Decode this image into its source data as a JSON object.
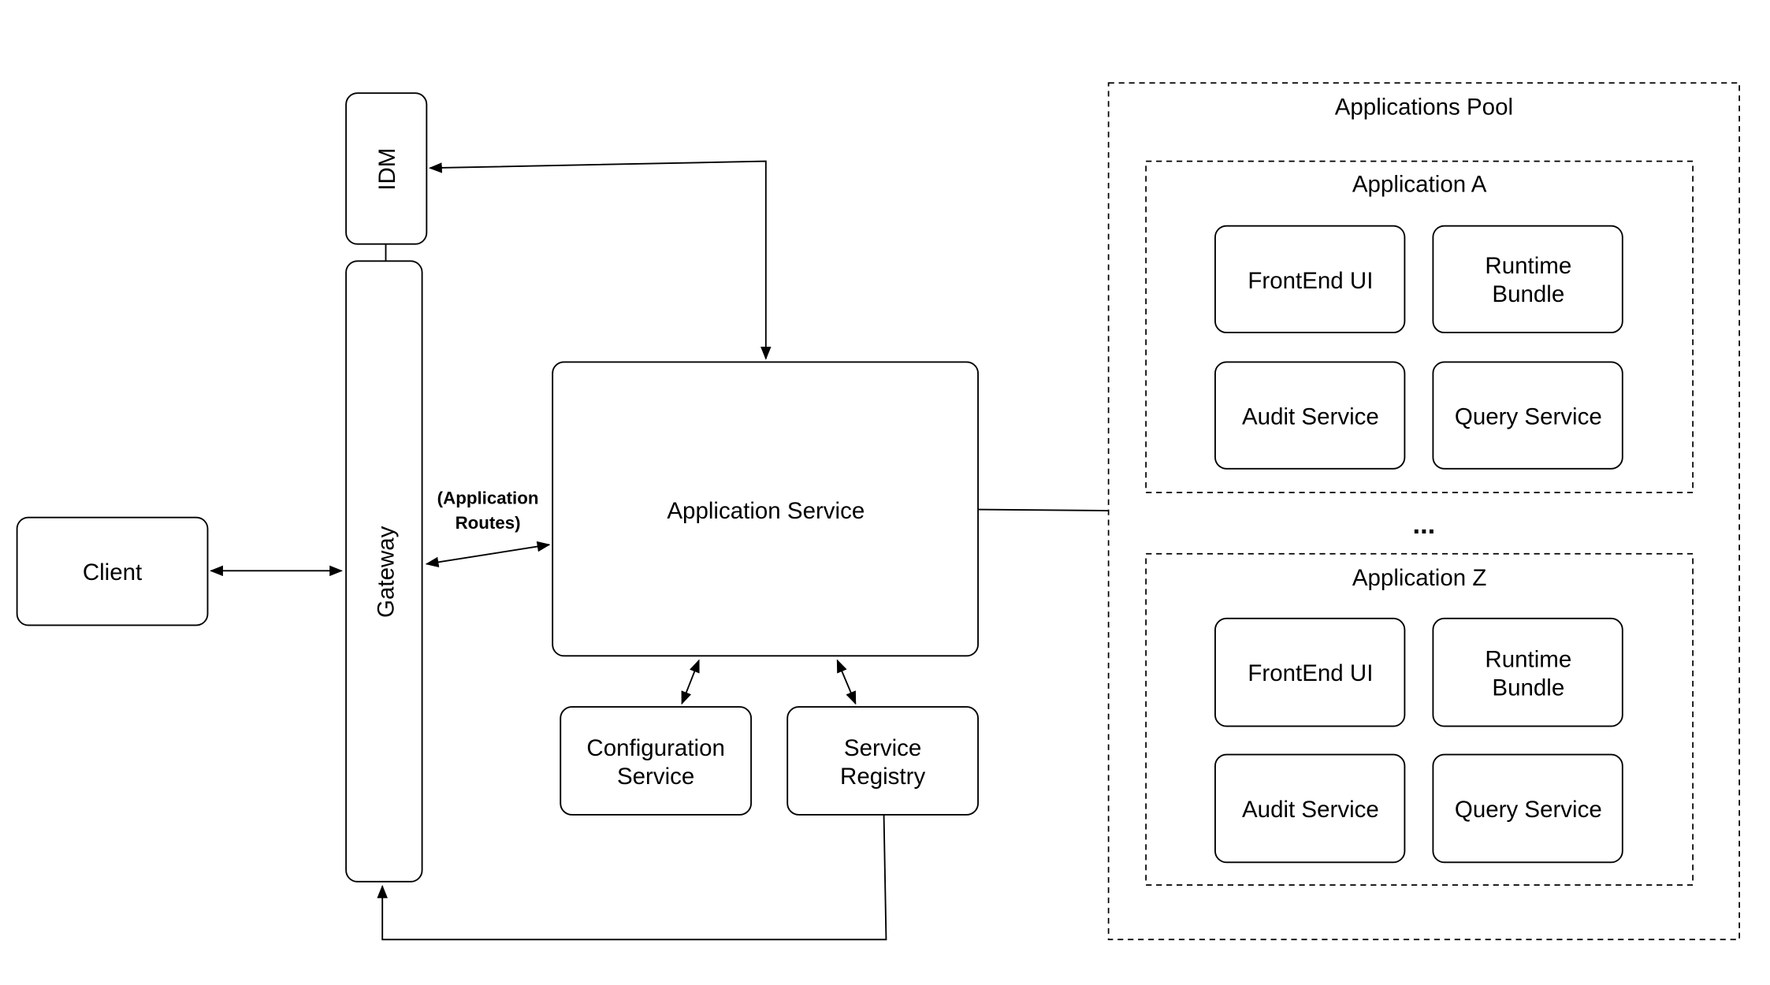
{
  "nodes": {
    "idm": "IDM",
    "gateway": "Gateway",
    "client": "Client",
    "application_service": "Application Service",
    "configuration_service": [
      "Configuration",
      "Service"
    ],
    "service_registry": [
      "Service",
      "Registry"
    ]
  },
  "edge_labels": {
    "application_routes": [
      "(Application",
      "Routes)"
    ]
  },
  "pool": {
    "title": "Applications Pool",
    "ellipsis": "...",
    "applications": [
      {
        "title": "Application A",
        "components": {
          "frontend": "FrontEnd UI",
          "runtime": [
            "Runtime",
            "Bundle"
          ],
          "audit": "Audit Service",
          "query": "Query Service"
        }
      },
      {
        "title": "Application Z",
        "components": {
          "frontend": "FrontEnd UI",
          "runtime": [
            "Runtime",
            "Bundle"
          ],
          "audit": "Audit Service",
          "query": "Query Service"
        }
      }
    ]
  }
}
